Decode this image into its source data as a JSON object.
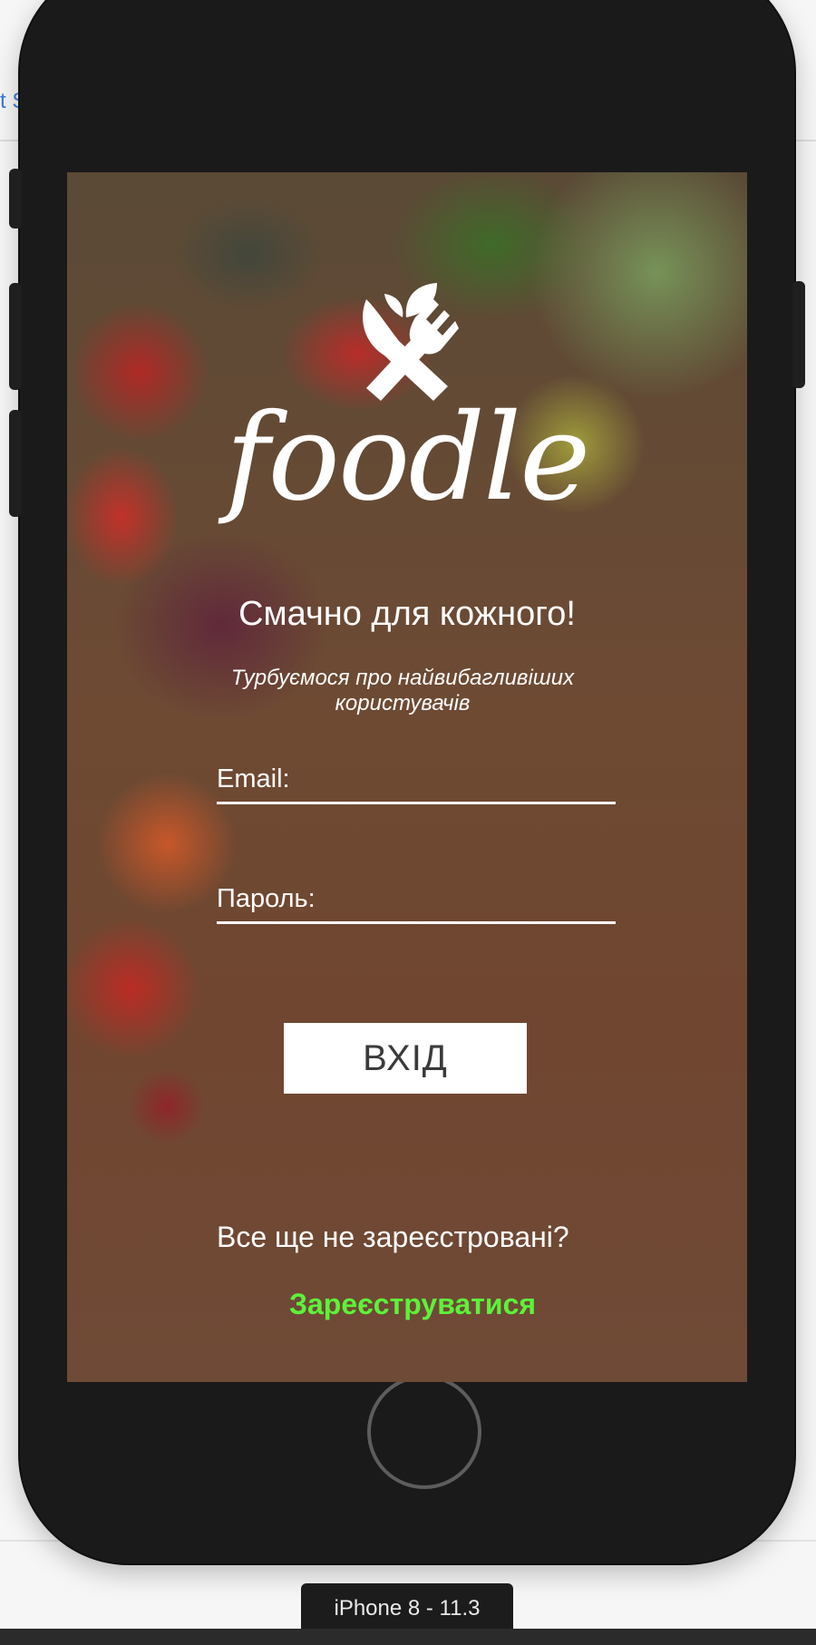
{
  "host": {
    "partial_link": "t S",
    "device_label": "iPhone 8 - 11.3"
  },
  "app": {
    "brand": "foodle",
    "logo_icon": "leaf-fork-knife-icon",
    "tagline": "Смачно для кожного!",
    "subtitle_line1": "Турбуємося про найвибагливіших",
    "subtitle_line2": "користувачів",
    "email_label": "Email:",
    "password_label": "Пароль:",
    "login_button": "ВХІД",
    "register_prompt": "Все ще не зареєстровані?",
    "register_link": "Зареєструватися"
  },
  "colors": {
    "register_link": "#5cf23a",
    "button_bg": "#ffffff",
    "device_body": "#1a1a1a"
  }
}
